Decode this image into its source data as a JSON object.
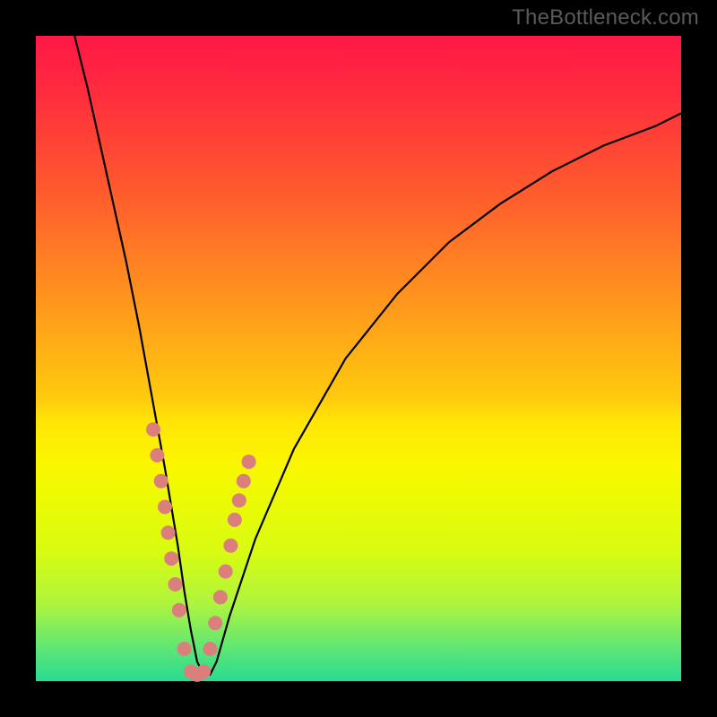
{
  "watermark": "TheBottleneck.com",
  "colors": {
    "frame": "#000000",
    "marker": "#da7f7c",
    "curve": "#000000",
    "gradient_top": "#ff1846",
    "gradient_bottom": "#28db92"
  },
  "chart_data": {
    "type": "line",
    "title": "",
    "xlabel": "",
    "ylabel": "",
    "xlim": [
      0,
      100
    ],
    "ylim": [
      0,
      100
    ],
    "grid": false,
    "legend": false,
    "notes": "V-shaped bottleneck curve on rainbow heat gradient (red=high bottleneck, green=low). Axes unlabeled; values are read off pixel positions normalized to 0–100.",
    "series": [
      {
        "name": "bottleneck-curve",
        "x": [
          6,
          8,
          10,
          12,
          14,
          16,
          18,
          20,
          21,
          22,
          23,
          24,
          25,
          26,
          27,
          28,
          30,
          34,
          40,
          48,
          56,
          64,
          72,
          80,
          88,
          96,
          100
        ],
        "y": [
          100,
          92,
          83,
          74,
          65,
          55,
          44,
          33,
          27,
          21,
          14,
          8,
          3,
          1,
          1,
          3,
          10,
          22,
          36,
          50,
          60,
          68,
          74,
          79,
          83,
          86,
          88
        ]
      }
    ],
    "markers": {
      "name": "highlighted-points",
      "x": [
        18.2,
        18.8,
        19.4,
        20.0,
        20.5,
        21.0,
        21.6,
        22.2,
        23.0,
        24.0,
        25.0,
        26.0,
        27.0,
        27.8,
        28.6,
        29.4,
        30.2,
        30.8,
        31.5,
        32.2,
        33.0
      ],
      "y": [
        39.0,
        35.0,
        31.0,
        27.0,
        23.0,
        19.0,
        15.0,
        11.0,
        5.0,
        1.5,
        1.0,
        1.5,
        5.0,
        9.0,
        13.0,
        17.0,
        21.0,
        25.0,
        28.0,
        31.0,
        34.0
      ]
    }
  }
}
